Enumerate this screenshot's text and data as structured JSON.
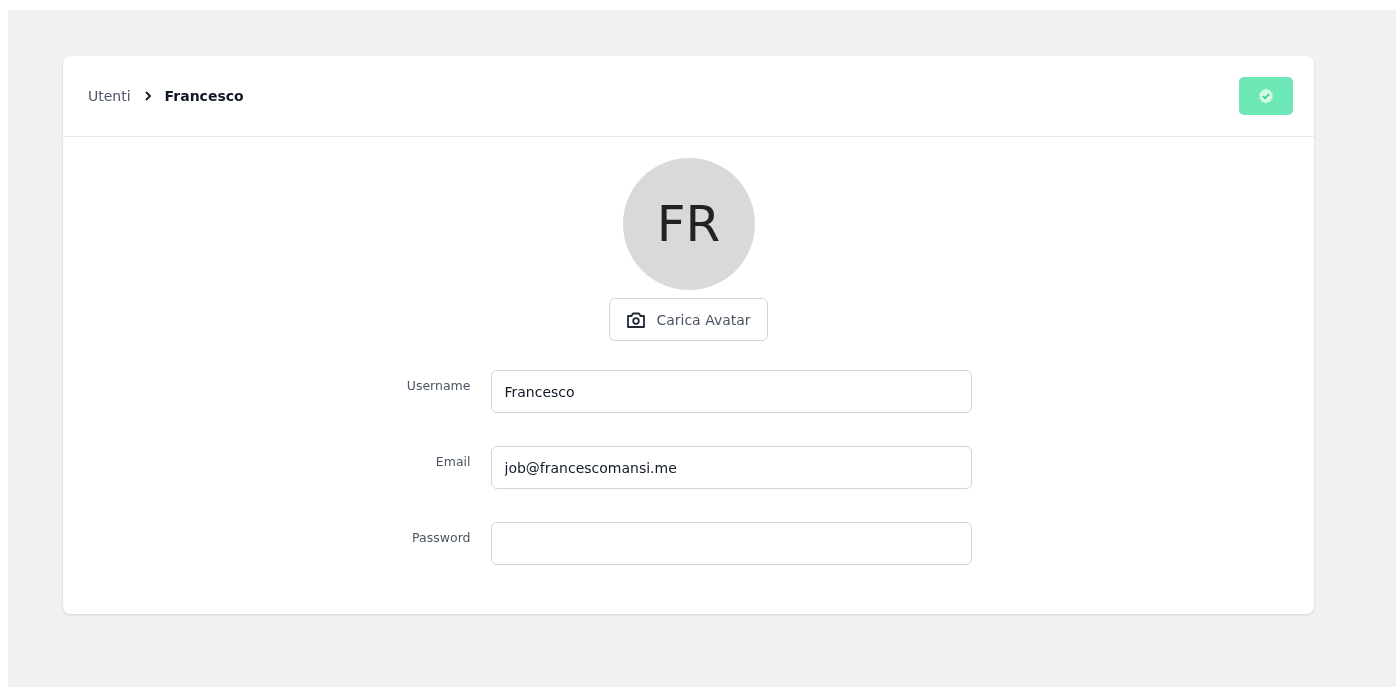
{
  "breadcrumb": [
    {
      "label": "Utenti",
      "current": false
    },
    {
      "label": "Francesco",
      "current": true
    }
  ],
  "save_button": {
    "disabled": true
  },
  "avatar": {
    "initials": "FR"
  },
  "upload_button": {
    "label": "Carica Avatar"
  },
  "fields": [
    {
      "label": "Username",
      "value": "Francesco"
    },
    {
      "label": "Email",
      "value": "job@francescomansi.me"
    },
    {
      "label": "Password"
    }
  ]
}
